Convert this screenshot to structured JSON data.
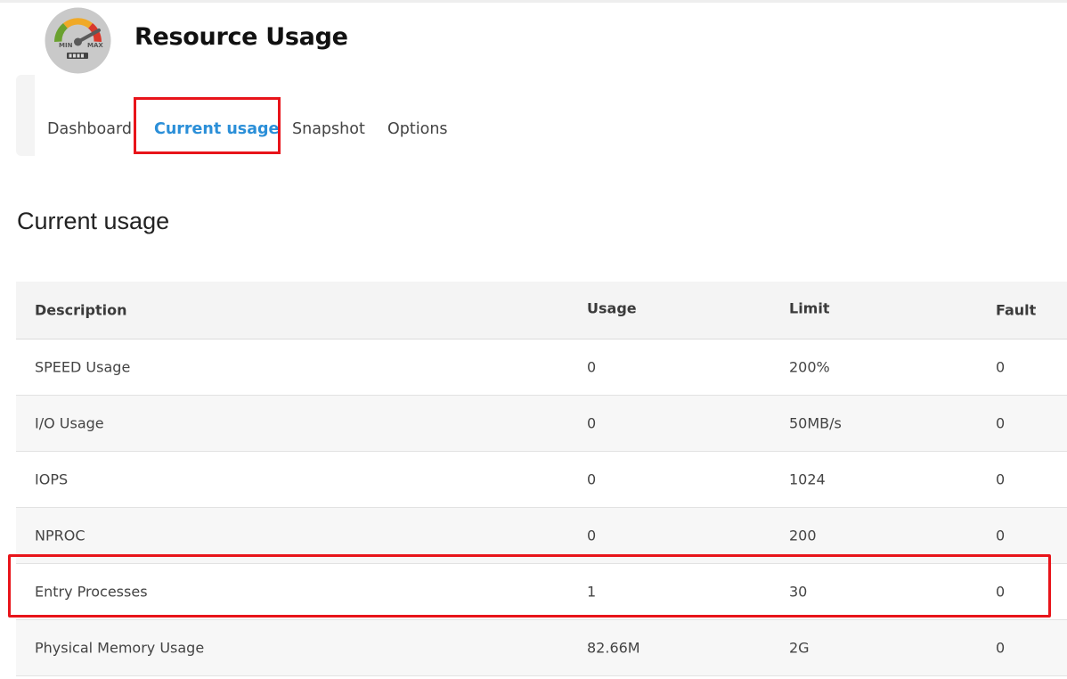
{
  "header": {
    "title": "Resource Usage",
    "logo_icon": "speedometer-gauge-icon",
    "logo_min": "MIN",
    "logo_max": "MAX"
  },
  "tabs": [
    {
      "label": "Dashboard",
      "active": false
    },
    {
      "label": "Current usage",
      "active": true
    },
    {
      "label": "Snapshot",
      "active": false
    },
    {
      "label": "Options",
      "active": false
    }
  ],
  "section": {
    "title": "Current usage"
  },
  "table": {
    "columns": [
      "Description",
      "Usage",
      "Limit",
      "Fault"
    ],
    "rows": [
      [
        "SPEED Usage",
        "0",
        "200%",
        "0"
      ],
      [
        "I/O Usage",
        "0",
        "50MB/s",
        "0"
      ],
      [
        "IOPS",
        "0",
        "1024",
        "0"
      ],
      [
        "NPROC",
        "0",
        "200",
        "0"
      ],
      [
        "Entry Processes",
        "1",
        "30",
        "0"
      ],
      [
        "Physical Memory Usage",
        "82.66M",
        "2G",
        "0"
      ]
    ]
  },
  "colors": {
    "accent": "#2b8fd8",
    "highlight": "#e8141a"
  }
}
